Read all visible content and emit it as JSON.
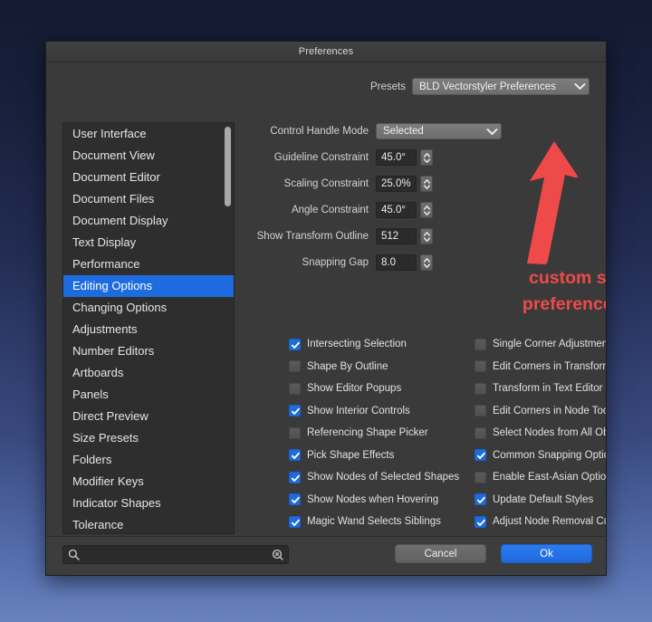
{
  "window": {
    "title": "Preferences"
  },
  "presets": {
    "label": "Presets",
    "value": "BLD Vectorstyler Preferences"
  },
  "sidebar": {
    "items": [
      {
        "label": "User Interface",
        "selected": false
      },
      {
        "label": "Document View",
        "selected": false
      },
      {
        "label": "Document Editor",
        "selected": false
      },
      {
        "label": "Document Files",
        "selected": false
      },
      {
        "label": "Document Display",
        "selected": false
      },
      {
        "label": "Text Display",
        "selected": false
      },
      {
        "label": "Performance",
        "selected": false
      },
      {
        "label": "Editing Options",
        "selected": true
      },
      {
        "label": "Changing Options",
        "selected": false
      },
      {
        "label": "Adjustments",
        "selected": false
      },
      {
        "label": "Number Editors",
        "selected": false
      },
      {
        "label": "Artboards",
        "selected": false
      },
      {
        "label": "Panels",
        "selected": false
      },
      {
        "label": "Direct Preview",
        "selected": false
      },
      {
        "label": "Size Presets",
        "selected": false
      },
      {
        "label": "Folders",
        "selected": false
      },
      {
        "label": "Modifier Keys",
        "selected": false
      },
      {
        "label": "Indicator Shapes",
        "selected": false
      },
      {
        "label": "Tolerance",
        "selected": false
      }
    ]
  },
  "fields": [
    {
      "label": "Control Handle Mode",
      "value": "Selected",
      "type": "popup"
    },
    {
      "label": "Guideline Constraint",
      "value": "45.0°",
      "type": "stepper"
    },
    {
      "label": "Scaling Constraint",
      "value": "25.0%",
      "type": "stepper"
    },
    {
      "label": "Angle Constraint",
      "value": "45.0°",
      "type": "stepper"
    },
    {
      "label": "Show Transform Outline",
      "value": "512",
      "type": "stepper"
    },
    {
      "label": "Snapping Gap",
      "value": "8.0",
      "type": "stepper"
    }
  ],
  "checkboxes": [
    {
      "label": "Intersecting Selection",
      "checked": true
    },
    {
      "label": "Single Corner Adjustment",
      "checked": false
    },
    {
      "label": "Shape By Outline",
      "checked": false
    },
    {
      "label": "Edit Corners in Transform Tool",
      "checked": false
    },
    {
      "label": "Show Editor Popups",
      "checked": false
    },
    {
      "label": "Transform in Text Editor",
      "checked": false
    },
    {
      "label": "Show Interior Controls",
      "checked": true
    },
    {
      "label": "Edit Corners in Node Tool",
      "checked": false
    },
    {
      "label": "Referencing Shape Picker",
      "checked": false
    },
    {
      "label": "Select Nodes from All Objects",
      "checked": false
    },
    {
      "label": "Pick Shape Effects",
      "checked": true
    },
    {
      "label": "Common Snapping Options",
      "checked": true
    },
    {
      "label": "Show Nodes of Selected Shapes",
      "checked": true
    },
    {
      "label": "Enable East-Asian Options",
      "checked": false
    },
    {
      "label": "Show Nodes when Hovering",
      "checked": true
    },
    {
      "label": "Update Default Styles",
      "checked": true
    },
    {
      "label": "Magic Wand Selects Siblings",
      "checked": true
    },
    {
      "label": "Adjust Node Removal Curvature",
      "checked": true
    }
  ],
  "search": {
    "value": "",
    "placeholder": ""
  },
  "buttons": {
    "cancel": "Cancel",
    "ok": "Ok"
  },
  "annotation": {
    "line1": "custom saved",
    "line2": "preferences file",
    "color": "#ee4a4a"
  },
  "colors": {
    "accent": "#1c6ce0",
    "dialog_bg": "#3a3a3a",
    "list_bg": "#2e2e2e",
    "annotation_red": "#ee4a4a"
  }
}
